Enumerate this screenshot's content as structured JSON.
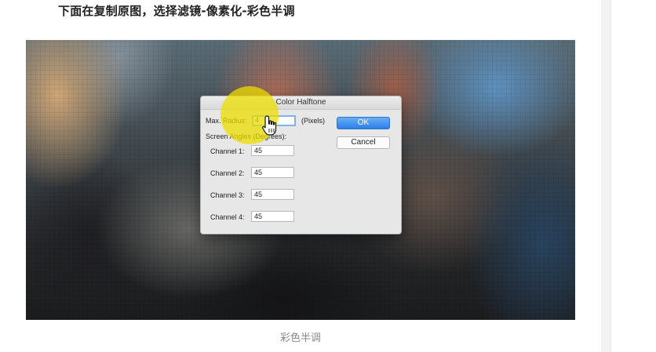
{
  "article": {
    "intro": "下面在复制原图，选择滤镜-像素化-彩色半调",
    "caption": "彩色半调"
  },
  "dialog": {
    "title": "Color Halftone",
    "max_radius_label": "Max. Radius:",
    "max_radius_value": "4",
    "units_label": "(Pixels)",
    "screen_angles_label": "Screen Angles (Degrees):",
    "channels": [
      {
        "label": "Channel 1:",
        "value": "45"
      },
      {
        "label": "Channel 2:",
        "value": "45"
      },
      {
        "label": "Channel 3:",
        "value": "45"
      },
      {
        "label": "Channel 4:",
        "value": "45"
      }
    ],
    "ok_label": "OK",
    "cancel_label": "Cancel"
  },
  "colors": {
    "spotlight": "#ecdc00",
    "primary_button": "#2a7fe8",
    "focus_ring": "#7fb2ee"
  },
  "icons": {
    "cursor": "hand-pointer-icon"
  }
}
